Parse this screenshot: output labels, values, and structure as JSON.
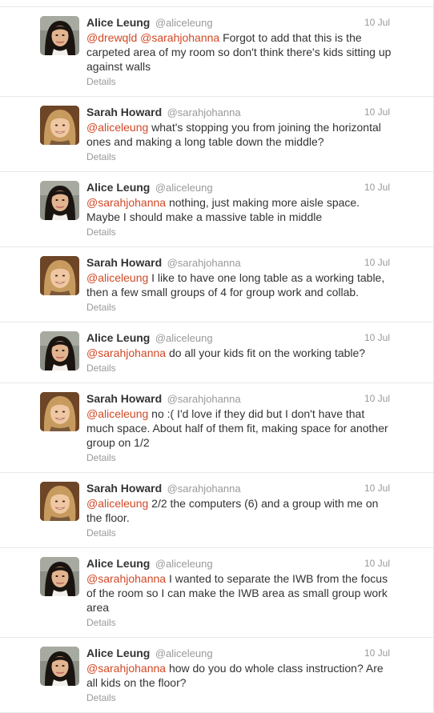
{
  "details_label": "Details",
  "tweets": [
    {
      "author": "alice",
      "fullname": "Alice Leung",
      "username": "@aliceleung",
      "time": "10 Jul",
      "mentions": [
        "@drewqld",
        "@sarahjohanna"
      ],
      "text": " Forgot to add that this is the carpeted area of my room so don't think there's kids sitting up against walls"
    },
    {
      "author": "sarah",
      "fullname": "Sarah Howard",
      "username": "@sarahjohanna",
      "time": "10 Jul",
      "mentions": [
        "@aliceleung"
      ],
      "text": " what's stopping you from joining the horizontal ones and making a long table down the middle?"
    },
    {
      "author": "alice",
      "fullname": "Alice Leung",
      "username": "@aliceleung",
      "time": "10 Jul",
      "mentions": [
        "@sarahjohanna"
      ],
      "text": " nothing, just making more aisle space. Maybe I should make a massive table in middle"
    },
    {
      "author": "sarah",
      "fullname": "Sarah Howard",
      "username": "@sarahjohanna",
      "time": "10 Jul",
      "mentions": [
        "@aliceleung"
      ],
      "text": " I like to have one long table as a working table, then a few small groups of 4 for group work and collab."
    },
    {
      "author": "alice",
      "fullname": "Alice Leung",
      "username": "@aliceleung",
      "time": "10 Jul",
      "mentions": [
        "@sarahjohanna"
      ],
      "text": " do all your kids fit on the working table?"
    },
    {
      "author": "sarah",
      "fullname": "Sarah Howard",
      "username": "@sarahjohanna",
      "time": "10 Jul",
      "mentions": [
        "@aliceleung"
      ],
      "text": " no :( I'd love if they did but I don't have that much space. About half of them fit, making space for another group on 1/2"
    },
    {
      "author": "sarah",
      "fullname": "Sarah Howard",
      "username": "@sarahjohanna",
      "time": "10 Jul",
      "mentions": [
        "@aliceleung"
      ],
      "text": " 2/2 the computers (6) and a group with me on the floor."
    },
    {
      "author": "alice",
      "fullname": "Alice Leung",
      "username": "@aliceleung",
      "time": "10 Jul",
      "mentions": [
        "@sarahjohanna"
      ],
      "text": " I wanted to separate the IWB from the focus of the room so I can make the IWB area as small group work area"
    },
    {
      "author": "alice",
      "fullname": "Alice Leung",
      "username": "@aliceleung",
      "time": "10 Jul",
      "mentions": [
        "@sarahjohanna"
      ],
      "text": " how do you do whole class instruction? Are all kids on the floor?"
    }
  ],
  "colors": {
    "mention": "#d14826",
    "muted": "#999999",
    "text": "#333333"
  }
}
